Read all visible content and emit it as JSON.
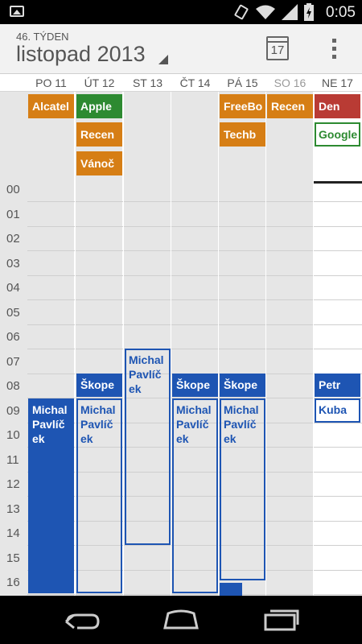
{
  "status_bar": {
    "time": "0:05",
    "icons": [
      "image-icon",
      "rotate-icon",
      "wifi-icon",
      "signal-icon",
      "battery-charging-icon"
    ]
  },
  "action_bar": {
    "week_label": "46. TÝDEN",
    "month_label": "listopad 2013",
    "today_number": "17"
  },
  "days": [
    {
      "label": "PO 11"
    },
    {
      "label": "ÚT 12"
    },
    {
      "label": "ST 13"
    },
    {
      "label": "ČT 14"
    },
    {
      "label": "PÁ 15"
    },
    {
      "label": "SO 16"
    },
    {
      "label": "NE 17"
    }
  ],
  "all_day_events": [
    {
      "title": "Alcatel",
      "day": 0,
      "row": 0,
      "color": "#d67e15"
    },
    {
      "title": "Apple",
      "day": 1,
      "row": 0,
      "color": "#2d8a31"
    },
    {
      "title": "Recen",
      "day": 1,
      "row": 1,
      "color": "#d67e15"
    },
    {
      "title": "Vánoč",
      "day": 1,
      "row": 2,
      "color": "#d67e15"
    },
    {
      "title": "FreeBo",
      "day": 4,
      "row": 0,
      "color": "#d67e15"
    },
    {
      "title": "Techb",
      "day": 4,
      "row": 1,
      "color": "#d67e15"
    },
    {
      "title": "Recen",
      "day": 5,
      "row": 0,
      "color": "#d67e15"
    },
    {
      "title": "Den",
      "day": 6,
      "row": 0,
      "color": "#b93b34"
    },
    {
      "title": "Google",
      "day": 6,
      "row": 1,
      "color": "#2d8a31"
    }
  ],
  "hours": [
    "00",
    "01",
    "02",
    "03",
    "04",
    "05",
    "06",
    "07",
    "08",
    "09",
    "10",
    "11",
    "12",
    "13",
    "14",
    "15",
    "16"
  ],
  "events": [
    {
      "title": "Michal Pavlíček",
      "line1": "Michal",
      "line2": "Pavlíč",
      "line3": "ek",
      "day": 0,
      "style": "solid"
    },
    {
      "title": "Škope",
      "day": 1,
      "style": "solid"
    },
    {
      "title": "Michal Pavlíček",
      "line1": "Michal",
      "line2": "Pavlíč",
      "line3": "ek",
      "day": 1,
      "style": "outline"
    },
    {
      "title": "Michal Pavlíček",
      "line1": "Michal",
      "line2": "Pavlíč",
      "line3": "ek",
      "day": 2,
      "style": "outline"
    },
    {
      "title": "Škope",
      "day": 3,
      "style": "solid"
    },
    {
      "title": "Michal Pavlíček",
      "line1": "Michal",
      "line2": "Pavlíč",
      "line3": "ek",
      "day": 3,
      "style": "outline"
    },
    {
      "title": "Škope",
      "day": 4,
      "style": "solid"
    },
    {
      "title": "Michal Pavlíček",
      "line1": "Michal",
      "line2": "Pavlíč",
      "line3": "ek",
      "day": 4,
      "style": "outline"
    },
    {
      "title": "Petr",
      "day": 6,
      "style": "solid"
    },
    {
      "title": "Kuba",
      "day": 6,
      "style": "outline"
    }
  ],
  "nav_bar": {
    "buttons": [
      "back-icon",
      "home-icon",
      "recents-icon"
    ]
  },
  "colors": {
    "event_blue": "#1e55b3",
    "orange": "#d67e15",
    "green": "#2d8a31",
    "red": "#b93b34",
    "grid_bg": "#e6e6e6"
  }
}
